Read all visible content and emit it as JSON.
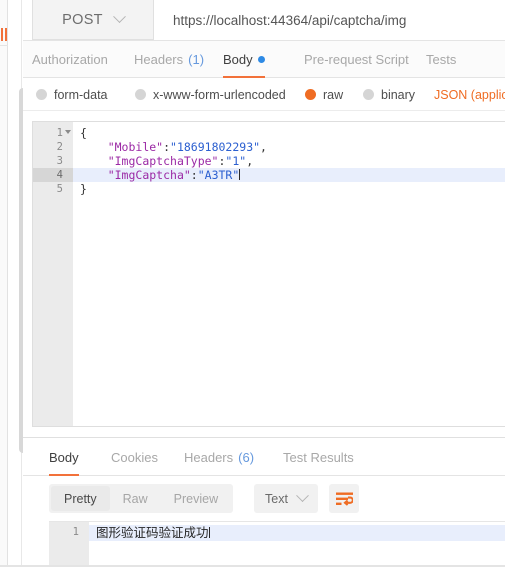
{
  "request": {
    "method": "POST",
    "url": "https://localhost:44364/api/captcha/img",
    "tabs": [
      {
        "label": "Authorization"
      },
      {
        "label": "Headers",
        "count": "(1)"
      },
      {
        "label": "Body",
        "dot": true
      },
      {
        "label": "Pre-request Script"
      },
      {
        "label": "Tests"
      }
    ],
    "body_types": [
      {
        "label": "form-data",
        "selected": false
      },
      {
        "label": "x-www-form-urlencoded",
        "selected": false
      },
      {
        "label": "raw",
        "selected": true
      },
      {
        "label": "binary",
        "selected": false
      }
    ],
    "content_type": "JSON (applic",
    "editor": {
      "lines": [
        {
          "num": "1",
          "folded": true,
          "text": "{"
        },
        {
          "num": "2",
          "key": "\"Mobile\"",
          "colon": ":",
          "value": "\"18691802293\"",
          "comma": ","
        },
        {
          "num": "3",
          "key": "\"ImgCaptchaType\"",
          "colon": ":",
          "value": "\"1\"",
          "comma": ","
        },
        {
          "num": "4",
          "key": "\"ImgCaptcha\"",
          "colon": ":",
          "value": "\"A3TR\"",
          "comma": "",
          "active": true
        },
        {
          "num": "5",
          "text": "}"
        }
      ]
    }
  },
  "response": {
    "tabs": [
      {
        "label": "Body",
        "active": true
      },
      {
        "label": "Cookies"
      },
      {
        "label": "Headers",
        "count": "(6)"
      },
      {
        "label": "Test Results"
      }
    ],
    "view_modes": [
      {
        "label": "Pretty",
        "active": true
      },
      {
        "label": "Raw",
        "active": false
      },
      {
        "label": "Preview",
        "active": false
      }
    ],
    "format": "Text",
    "body": {
      "line_number": "1",
      "text": "图形验证码验证成功"
    }
  },
  "colors": {
    "accent": "#f2713a",
    "link": "#6699dd",
    "json_key": "#9b29a5",
    "json_value": "#2b5fd0",
    "radio_on": "#ef6c23",
    "dot": "#2e8ae5"
  }
}
